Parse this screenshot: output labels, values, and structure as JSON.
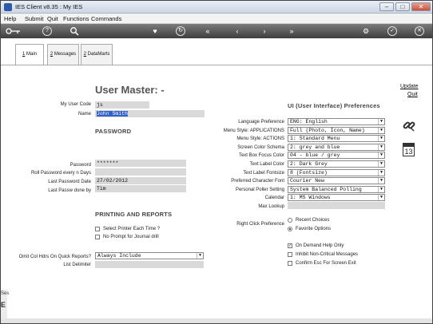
{
  "window": {
    "title": "IES Client v8.35 : My IES",
    "min": "–",
    "max": "□",
    "close": "✕"
  },
  "menu": [
    "Help",
    "Submit",
    "Quit",
    "Functions",
    "Commands"
  ],
  "toolbar_icons": [
    "key-icon",
    "help-icon",
    "search-icon",
    "heart-icon",
    "refresh-icon",
    "rewind-icon",
    "back-icon",
    "forward-icon",
    "fast-forward-icon",
    "settings-icon",
    "check-icon",
    "close-icon"
  ],
  "tabs": [
    {
      "num": "1",
      "label": " Main"
    },
    {
      "num": "2",
      "label": " Messages"
    },
    {
      "num": "2",
      "label": " DataMarts"
    }
  ],
  "page": {
    "title": "User Master: -",
    "update": "Update",
    "quit": "Quit"
  },
  "user": {
    "code_label": "My User Code",
    "code_value": "js",
    "name_label": "Name",
    "name_value": "John Smith"
  },
  "password": {
    "section": "PASSWORD",
    "password_label": "Password",
    "password_value": "*******",
    "roll_label": "Roll Password every n Days",
    "roll_value": "",
    "last_date_label": "Last Password Date",
    "last_date_value": "27/02/2012",
    "last_by_label": "Last Passw done by",
    "last_by_value": "Tim"
  },
  "printing": {
    "section": "PRINTING AND REPORTS",
    "select_printer": "Select Printer Each Time ?",
    "no_prompt": "No Prompt for Journal drill",
    "omit_label": "Omit Col Hdrs On Quick Reports?",
    "omit_value": "Always Include",
    "delim_label": "List Delimiter",
    "delim_value": ""
  },
  "ui": {
    "section": "UI (User Interface) Preferences",
    "rows": [
      {
        "label": "Language Preference",
        "value": "ENG: English"
      },
      {
        "label": "Menu Style: APPLICATIONS",
        "value": "Full (Photo, Icon, Name)"
      },
      {
        "label": "Menu Style: ACTIONS",
        "value": "1: Standard Menu"
      },
      {
        "label": "Screen Color Schema",
        "value": "2: grey and blue"
      },
      {
        "label": "Text Box Focus Color",
        "value": "04 - blue / grey"
      },
      {
        "label": "Text Label Color",
        "value": "2: Dark Grey"
      },
      {
        "label": "Text Label Fontsize",
        "value": "8 (Fontsize)"
      },
      {
        "label": "Preferred Character Font",
        "value": "Courier New"
      },
      {
        "label": "Personal Poller Setting",
        "value": "System Balanced Polling"
      },
      {
        "label": "Calendar",
        "value": "1: MS Windows"
      }
    ],
    "max_lookup_label": "Max Lookup",
    "max_lookup_value": "",
    "right_click_label": "Right Click Preference",
    "recent_choices": "Recent Choices",
    "favorite_options": "Favorite Options",
    "on_demand": "On Demand Help Only",
    "inhibit": "Inhibit Non-Critical Messages",
    "confirm_esc": "Confirm Esc For Screen Exit"
  },
  "side_icons": {
    "link": "link-icon",
    "calendar_num": "13"
  },
  "side_labels": {
    "top": "Ses",
    "bottom": "E"
  }
}
